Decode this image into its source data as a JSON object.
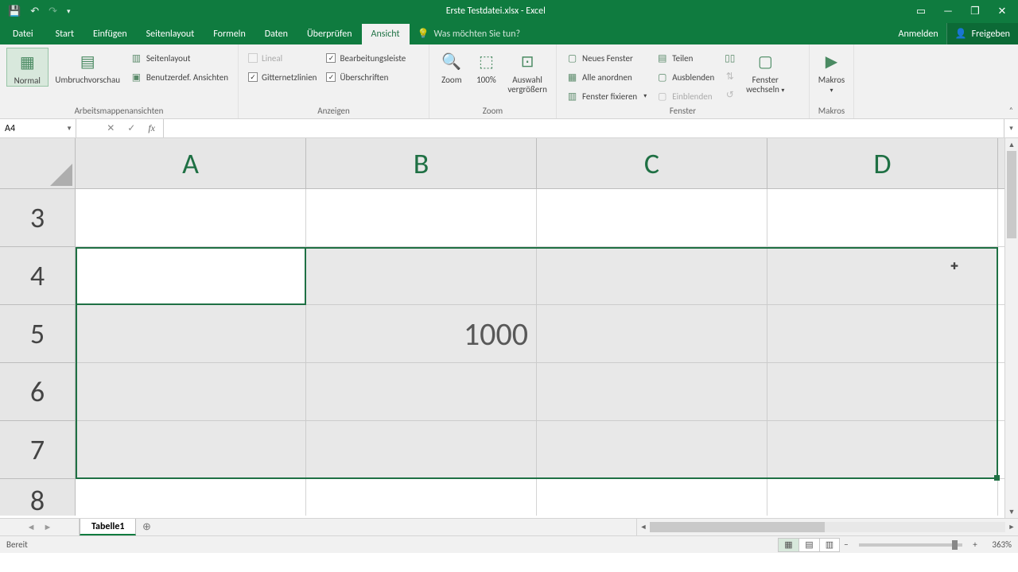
{
  "title": "Erste Testdatei.xlsx - Excel",
  "qat": {
    "save": "💾",
    "undo": "↶",
    "redo": "↷",
    "more": "▾"
  },
  "window": {
    "opts": "▭",
    "min": "—",
    "restore": "❐",
    "close": "✕"
  },
  "tabs": {
    "file": "Datei",
    "items": [
      "Start",
      "Einfügen",
      "Seitenlayout",
      "Formeln",
      "Daten",
      "Überprüfen",
      "Ansicht"
    ],
    "active": "Ansicht",
    "tellme": "Was möchten Sie tun?",
    "signin": "Anmelden",
    "share": "Freigeben"
  },
  "ribbon": {
    "views": {
      "normal": "Normal",
      "pagebreak": "Umbruchvorschau",
      "pagelayout": "Seitenlayout",
      "custom": "Benutzerdef. Ansichten",
      "group": "Arbeitsmappenansichten"
    },
    "show": {
      "ruler": "Lineal",
      "formulabar": "Bearbeitungsleiste",
      "gridlines": "Gitternetzlinien",
      "headings": "Überschriften",
      "group": "Anzeigen"
    },
    "zoom": {
      "zoom": "Zoom",
      "hundred": "100%",
      "selection1": "Auswahl",
      "selection2": "vergrößern",
      "group": "Zoom"
    },
    "window": {
      "new": "Neues Fenster",
      "arrange": "Alle anordnen",
      "freeze": "Fenster fixieren",
      "split": "Teilen",
      "hide": "Ausblenden",
      "unhide": "Einblenden",
      "switch1": "Fenster",
      "switch2": "wechseln",
      "group": "Fenster"
    },
    "macros": {
      "label": "Makros",
      "group": "Makros"
    }
  },
  "namebox": "A4",
  "formula": "",
  "columns": [
    "A",
    "B",
    "C",
    "D"
  ],
  "rows": [
    "3",
    "4",
    "5",
    "6",
    "7",
    "8"
  ],
  "cells": {
    "B5": "1000"
  },
  "sheet": "Tabelle1",
  "status": "Bereit",
  "zoom": "363%"
}
